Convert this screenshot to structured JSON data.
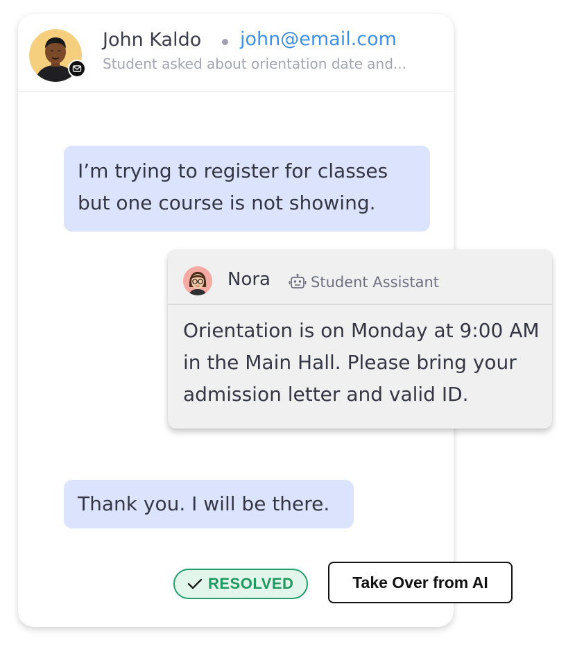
{
  "contact": {
    "name": "John Kaldo",
    "email": "john@email.com",
    "summary": "Student asked about orientation date and...",
    "channel_icon": "mail-icon"
  },
  "messages": [
    {
      "sender": "user",
      "text": "I’m trying to register for classes but one course is not showing."
    },
    {
      "sender": "assistant",
      "text": "Orientation is on Monday at 9:00 AM in the Main Hall. Please bring your admission letter and valid ID."
    },
    {
      "sender": "user",
      "text": "Thank you. I will be there."
    }
  ],
  "assistant": {
    "name": "Nora",
    "role": "Student Assistant",
    "role_icon": "robot-icon"
  },
  "status": {
    "label": "RESOLVED",
    "icon": "check-icon",
    "color": "#22a06b"
  },
  "actions": {
    "takeover_label": "Take Over from AI"
  },
  "colors": {
    "user_bubble": "#dbe3fd",
    "assistant_card": "#f0f0f0",
    "email_link": "#3f8fe8"
  }
}
